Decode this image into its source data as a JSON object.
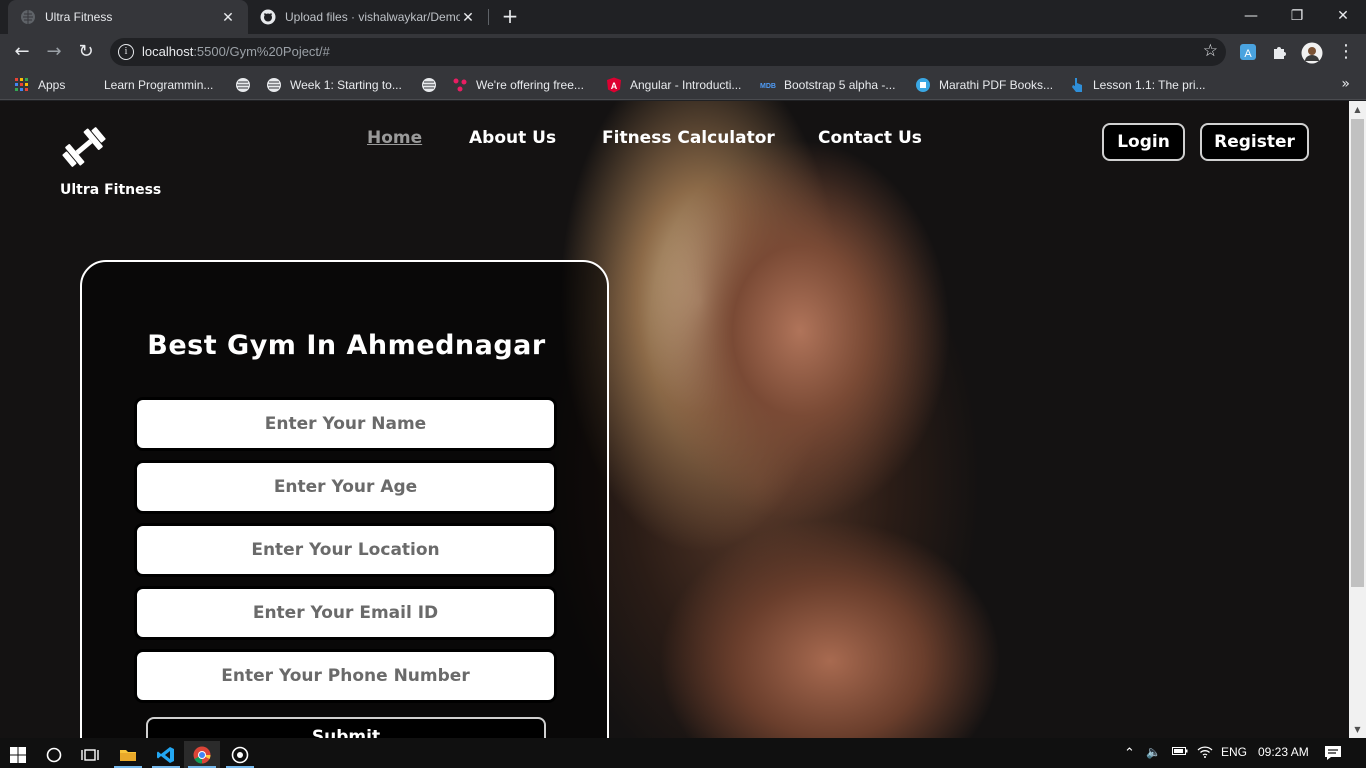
{
  "browser": {
    "tabs": [
      {
        "title": "Ultra Fitness",
        "active": true
      },
      {
        "title": "Upload files · vishalwaykar/Demo",
        "active": false
      }
    ],
    "url_host": "localhost",
    "url_rest": ":5500/Gym%20Poject/#",
    "bookmarks": [
      {
        "label": "Apps",
        "icon": "apps-grid-icon"
      },
      {
        "label": "Learn Programmin...",
        "icon": "blank-icon"
      },
      {
        "label": "",
        "icon": "globe-icon"
      },
      {
        "label": "Week 1: Starting to...",
        "icon": "globe-icon"
      },
      {
        "label": "",
        "icon": "globe-icon"
      },
      {
        "label": "We're offering free...",
        "icon": "dots-icon"
      },
      {
        "label": "Angular - Introducti...",
        "icon": "angular-icon"
      },
      {
        "label": "Bootstrap 5 alpha -...",
        "icon": "mdb-icon"
      },
      {
        "label": "Marathi PDF Books...",
        "icon": "book-icon"
      },
      {
        "label": "Lesson 1.1: The pri...",
        "icon": "pointer-icon"
      }
    ]
  },
  "site": {
    "brand": "Ultra Fitness",
    "nav": [
      {
        "label": "Home",
        "active": true
      },
      {
        "label": "About Us",
        "active": false
      },
      {
        "label": "Fitness Calculator",
        "active": false
      },
      {
        "label": "Contact Us",
        "active": false
      }
    ],
    "login": "Login",
    "register": "Register",
    "form": {
      "title": "Best Gym In Ahmednagar",
      "name_placeholder": "Enter Your Name",
      "age_placeholder": "Enter Your Age",
      "location_placeholder": "Enter Your Location",
      "email_placeholder": "Enter Your Email ID",
      "phone_placeholder": "Enter Your Phone Number",
      "submit": "Submit"
    }
  },
  "taskbar": {
    "language": "ENG",
    "time": "09:23 AM"
  },
  "colors": {
    "page_bg": "#141415",
    "nav_active": "#9a9a9a",
    "accent_text": "#ffffff"
  }
}
